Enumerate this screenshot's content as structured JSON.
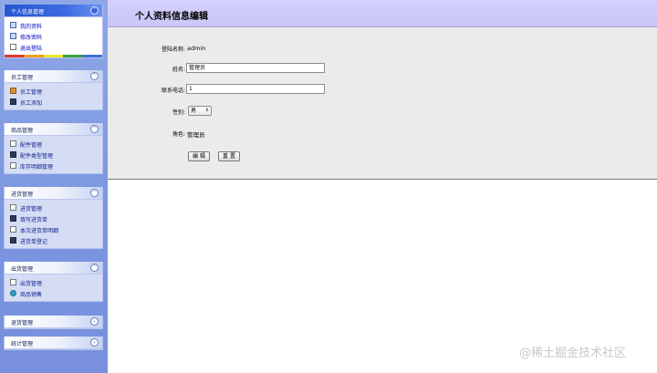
{
  "sidebar": {
    "groups": [
      {
        "title": "个人信息管理",
        "toggle": "⌃",
        "items": [
          {
            "label": "我的资料",
            "icon": "cards-icon"
          },
          {
            "label": "修改密码",
            "icon": "cards-icon"
          },
          {
            "label": "退出登陆",
            "icon": "document-icon"
          }
        ]
      },
      {
        "title": "员工管理",
        "toggle": "⌃",
        "items": [
          {
            "label": "员工管理",
            "icon": "people-icon"
          },
          {
            "label": "员工添加",
            "icon": "save-disk-icon"
          }
        ]
      },
      {
        "title": "商品管理",
        "toggle": "⌃",
        "items": [
          {
            "label": "配件管理",
            "icon": "document-icon"
          },
          {
            "label": "配件类型管理",
            "icon": "save-disk-icon"
          },
          {
            "label": "库存明细管理",
            "icon": "document-icon"
          }
        ]
      },
      {
        "title": "进货管理",
        "toggle": "⌃",
        "items": [
          {
            "label": "进货管理",
            "icon": "document-icon"
          },
          {
            "label": "填写进货单",
            "icon": "save-disk-icon"
          },
          {
            "label": "本次进货单明细",
            "icon": "document-icon"
          },
          {
            "label": "进货单登记",
            "icon": "save-disk-icon"
          }
        ]
      },
      {
        "title": "出货管理",
        "toggle": "⌃",
        "items": [
          {
            "label": "出货管理",
            "icon": "document-icon"
          },
          {
            "label": "商品销售",
            "icon": "globe-icon"
          }
        ]
      },
      {
        "title": "退货管理",
        "toggle": "⌄",
        "items": []
      },
      {
        "title": "统计管理",
        "toggle": "⌄",
        "items": []
      }
    ]
  },
  "main": {
    "title": "个人资料信息编辑",
    "form": {
      "login_label": "登陆名称:",
      "login_value": "admin",
      "name_label": "姓名:",
      "name_value": "管理员",
      "phone_label": "联系电话:",
      "phone_value": "1",
      "gender_label": "性别:",
      "gender_value": "男",
      "role_label": "角色:",
      "role_value": "管理员",
      "edit_button": "编 辑",
      "reset_button": "重 置"
    }
  },
  "watermark": "@稀土掘金技术社区",
  "colors": {
    "sidebar_bg": "#7f98e0",
    "active_header": "#2f5fd8",
    "topbar_bg": "#cfcbf9",
    "form_bg": "#ebebeb"
  }
}
